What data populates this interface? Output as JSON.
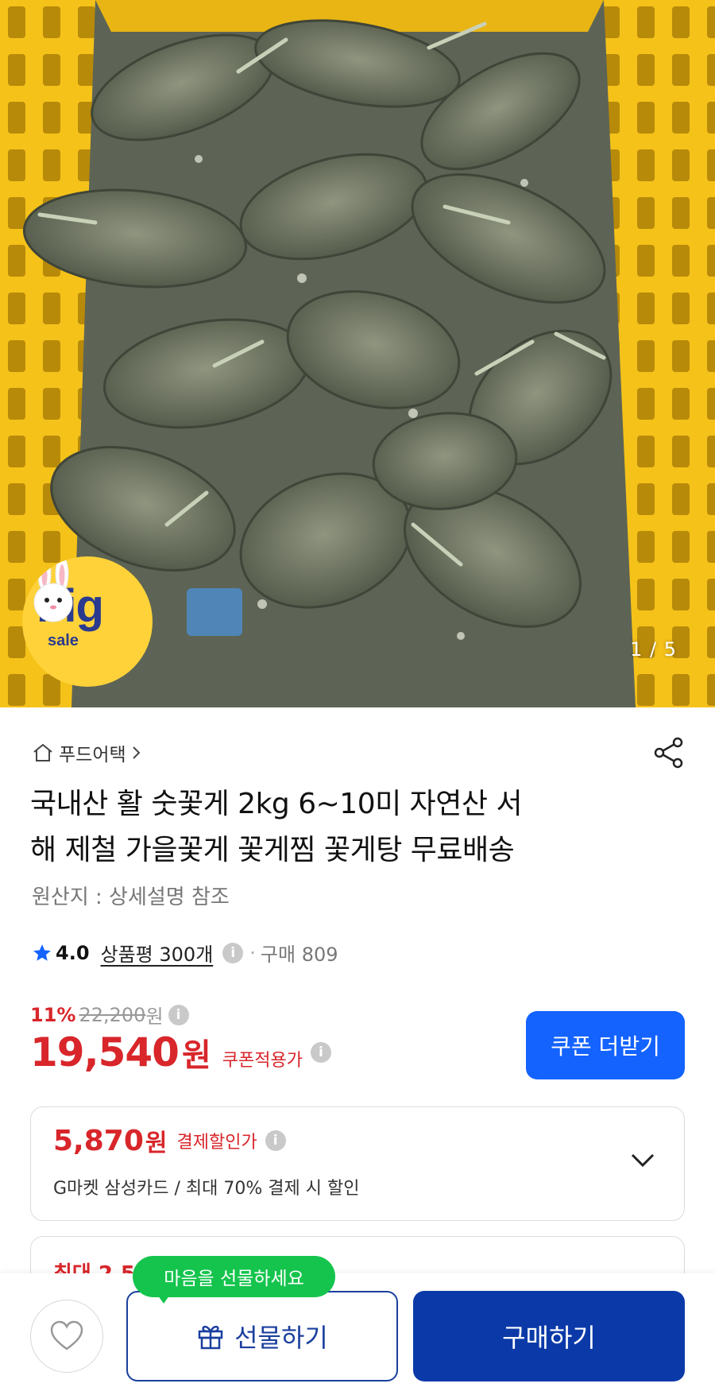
{
  "hero": {
    "image_counter": "1 / 5",
    "badge": {
      "big": "big",
      "sale": "sale"
    }
  },
  "seller": {
    "name": "푸드어택"
  },
  "product": {
    "title_line1": "국내산 활 숫꽃게 2kg 6~10미 자연산 서",
    "title_line2": "해 제철 가을꽃게 꽃게찜 꽃게탕 무료배송",
    "origin": "원산지 : 상세설명 참조"
  },
  "rating": {
    "score": "4.0",
    "reviews_label": "상품평 300개",
    "purchase_label": "구매 809"
  },
  "price": {
    "discount": "11%",
    "original": "22,200",
    "original_won": "원",
    "current": "19,540",
    "current_won": "원",
    "coupon_applied_label": "쿠폰적용가",
    "coupon_button": "쿠폰 더받기"
  },
  "payment_discount": {
    "amount": "5,870",
    "won": "원",
    "label": "결제할인가",
    "description": "G마켓 삼성카드 / 최대 70% 결제 시 할인"
  },
  "second_card": {
    "partial_text": "최대 2.5"
  },
  "bottom_bar": {
    "tooltip": "마음을 선물하세요",
    "gift_button": "선물하기",
    "buy_button": "구매하기"
  },
  "colors": {
    "accent_blue": "#1463ff",
    "buy_blue": "#0b3aa8",
    "price_red": "#d8262b",
    "tooltip_green": "#15c44d",
    "crate_yellow": "#f5c21a"
  }
}
